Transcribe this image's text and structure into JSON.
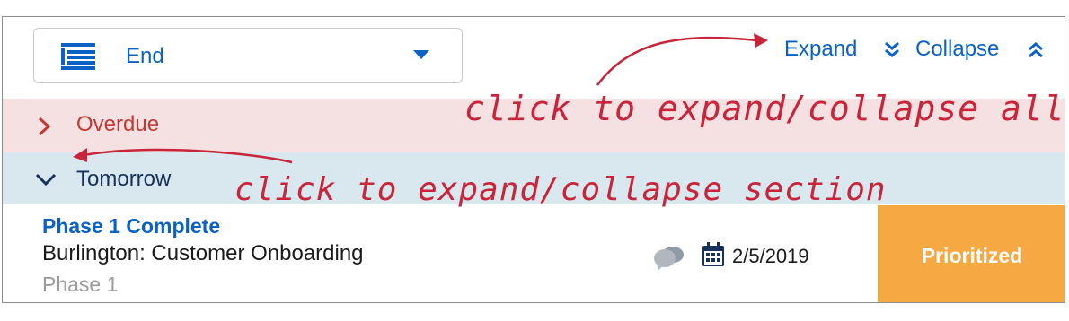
{
  "select": {
    "value": "End",
    "icon": "list-lines-icon"
  },
  "toolbar": {
    "expand_label": "Expand",
    "collapse_label": "Collapse"
  },
  "sections": [
    {
      "label": "Overdue",
      "state": "collapsed",
      "color": "#c23934",
      "background": "#f5e1e2"
    },
    {
      "label": "Tomorrow",
      "state": "expanded",
      "color": "#16325c",
      "background": "#d9e7ee"
    }
  ],
  "card": {
    "title": "Phase 1 Complete",
    "subtitle": "Burlington: Customer Onboarding",
    "phase": "Phase 1",
    "date": "2/5/2019",
    "status": "Prioritized",
    "status_color": "#f6a843"
  },
  "annotations": {
    "top": "click to expand/collapse all sections",
    "section": "click to expand/collapse section",
    "color": "#c8243a"
  },
  "colors": {
    "accent": "#0b61c4"
  }
}
